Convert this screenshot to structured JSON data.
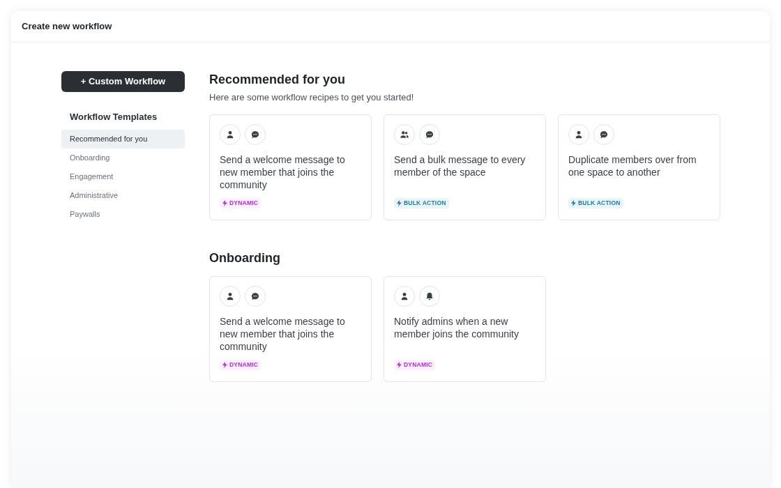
{
  "window": {
    "title": "Create new workflow"
  },
  "sidebar": {
    "button": "+ Custom Workflow",
    "heading": "Workflow Templates",
    "items": [
      {
        "label": "Recommended for you",
        "selected": true
      },
      {
        "label": "Onboarding",
        "selected": false
      },
      {
        "label": "Engagement",
        "selected": false
      },
      {
        "label": "Administrative",
        "selected": false
      },
      {
        "label": "Paywalls",
        "selected": false
      }
    ]
  },
  "sections": [
    {
      "title": "Recommended for you",
      "subtitle": "Here are some workflow recipes to get you started!",
      "cards": [
        {
          "icons": [
            {
              "kind": "person"
            },
            {
              "kind": "chat"
            }
          ],
          "title": "Send a welcome message to new member that joins the community",
          "tag": {
            "kind": "dynamic",
            "label": "DYNAMIC"
          }
        },
        {
          "icons": [
            {
              "kind": "people"
            },
            {
              "kind": "chat"
            }
          ],
          "title": "Send a bulk message to every member of the space",
          "tag": {
            "kind": "bulk",
            "label": "BULK ACTION"
          }
        },
        {
          "icons": [
            {
              "kind": "person"
            },
            {
              "kind": "chat"
            }
          ],
          "title": "Duplicate members over from one space to another",
          "tag": {
            "kind": "bulk",
            "label": "BULK ACTION"
          }
        }
      ]
    },
    {
      "title": "Onboarding",
      "cards": [
        {
          "icons": [
            {
              "kind": "person"
            },
            {
              "kind": "chat"
            }
          ],
          "title": "Send a welcome message to new member that joins the community",
          "tag": {
            "kind": "dynamic",
            "label": "DYNAMIC"
          }
        },
        {
          "icons": [
            {
              "kind": "person"
            },
            {
              "kind": "bell"
            }
          ],
          "title": "Notify admins when a new member joins the community",
          "tag": {
            "kind": "dynamic",
            "label": "DYNAMIC"
          }
        }
      ]
    }
  ]
}
